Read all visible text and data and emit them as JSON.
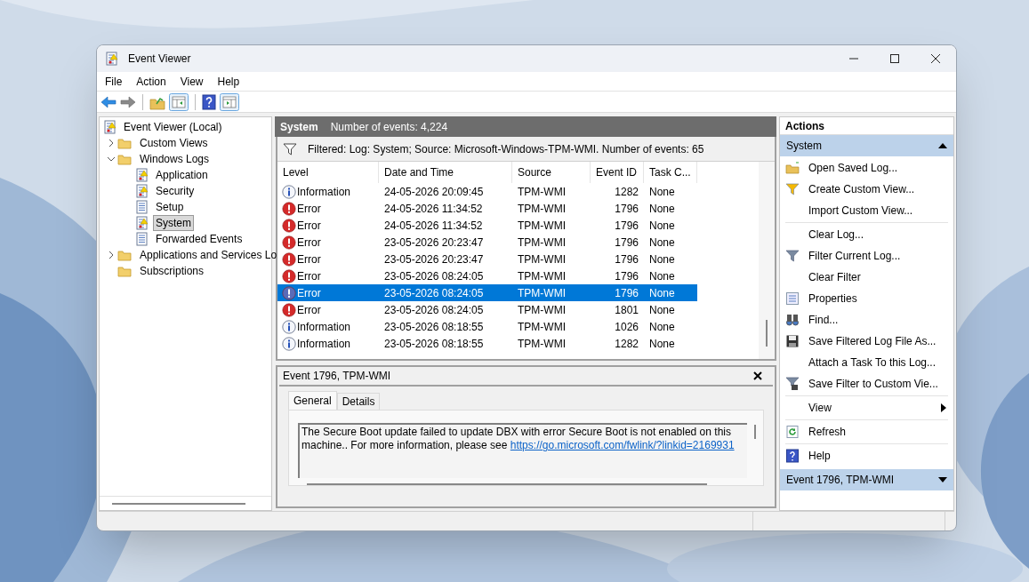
{
  "window": {
    "title": "Event Viewer"
  },
  "menu": [
    "File",
    "Action",
    "View",
    "Help"
  ],
  "tree": [
    {
      "label": "Event Viewer (Local)",
      "selected": false,
      "children": [
        {
          "label": "Custom Views",
          "expanded": false,
          "selected": false
        },
        {
          "label": "Windows Logs",
          "expanded": true,
          "selected": false,
          "children": [
            {
              "label": "Application",
              "selected": false
            },
            {
              "label": "Security",
              "selected": false
            },
            {
              "label": "Setup",
              "selected": false
            },
            {
              "label": "System",
              "selected": true
            },
            {
              "label": "Forwarded Events",
              "selected": false
            }
          ]
        },
        {
          "label": "Applications and Services Lo",
          "expanded": false,
          "selected": false
        },
        {
          "label": "Subscriptions",
          "selected": false
        }
      ]
    }
  ],
  "log_header": {
    "name": "System",
    "count": "Number of events: 4,224"
  },
  "filter": "Filtered: Log: System; Source: Microsoft-Windows-TPM-WMI. Number of events: 65",
  "table": {
    "columns": [
      "Level",
      "Date and Time",
      "Source",
      "Event ID",
      "Task C..."
    ],
    "rows": [
      {
        "kind": "information",
        "level": "Information",
        "date": "24-05-2026 20:09:45",
        "source": "TPM-WMI",
        "event_id": "1282",
        "task": "None",
        "selected": false
      },
      {
        "kind": "error",
        "level": "Error",
        "date": "24-05-2026 11:34:52",
        "source": "TPM-WMI",
        "event_id": "1796",
        "task": "None",
        "selected": false
      },
      {
        "kind": "error",
        "level": "Error",
        "date": "24-05-2026 11:34:52",
        "source": "TPM-WMI",
        "event_id": "1796",
        "task": "None",
        "selected": false
      },
      {
        "kind": "error",
        "level": "Error",
        "date": "23-05-2026 20:23:47",
        "source": "TPM-WMI",
        "event_id": "1796",
        "task": "None",
        "selected": false
      },
      {
        "kind": "error",
        "level": "Error",
        "date": "23-05-2026 20:23:47",
        "source": "TPM-WMI",
        "event_id": "1796",
        "task": "None",
        "selected": false
      },
      {
        "kind": "error",
        "level": "Error",
        "date": "23-05-2026 08:24:05",
        "source": "TPM-WMI",
        "event_id": "1796",
        "task": "None",
        "selected": false
      },
      {
        "kind": "error",
        "level": "Error",
        "date": "23-05-2026 08:24:05",
        "source": "TPM-WMI",
        "event_id": "1796",
        "task": "None",
        "selected": true
      },
      {
        "kind": "error",
        "level": "Error",
        "date": "23-05-2026 08:24:05",
        "source": "TPM-WMI",
        "event_id": "1801",
        "task": "None",
        "selected": false
      },
      {
        "kind": "information",
        "level": "Information",
        "date": "23-05-2026 08:18:55",
        "source": "TPM-WMI",
        "event_id": "1026",
        "task": "None",
        "selected": false
      },
      {
        "kind": "information",
        "level": "Information",
        "date": "23-05-2026 08:18:55",
        "source": "TPM-WMI",
        "event_id": "1282",
        "task": "None",
        "selected": false
      }
    ]
  },
  "detail": {
    "title": "Event 1796, TPM-WMI",
    "tabs": [
      {
        "label": "General",
        "selected": true
      },
      {
        "label": "Details",
        "selected": false
      }
    ],
    "message": "The Secure Boot update failed to update DBX with error Secure Boot is not enabled on this machine.. For more information, please see",
    "link": "https://go.microsoft.com/fwlink/?linkid=2169931"
  },
  "actions": {
    "title": "Actions",
    "sections": [
      {
        "title": "System",
        "expanded": true,
        "groups": [
          [
            {
              "label": "Open Saved Log..."
            },
            {
              "label": "Create Custom View..."
            },
            {
              "label": "Import Custom View..."
            }
          ],
          [
            {
              "label": "Clear Log..."
            },
            {
              "label": "Filter Current Log..."
            },
            {
              "label": "Clear Filter"
            },
            {
              "label": "Properties"
            },
            {
              "label": "Find..."
            },
            {
              "label": "Save Filtered Log File As..."
            },
            {
              "label": "Attach a Task To this Log..."
            },
            {
              "label": "Save Filter to Custom Vie..."
            }
          ],
          [
            {
              "label": "View",
              "submenu": true
            }
          ],
          [
            {
              "label": "Refresh"
            }
          ],
          [
            {
              "label": "Help"
            }
          ]
        ]
      },
      {
        "title": "Event 1796, TPM-WMI",
        "expanded": false
      }
    ]
  }
}
